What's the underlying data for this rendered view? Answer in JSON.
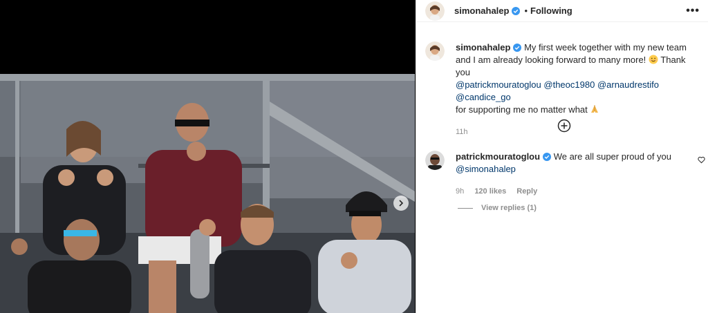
{
  "post": {
    "author": "simonahalep",
    "follow_status": "Following",
    "more_label": "•••",
    "caption": {
      "user": "simonahalep",
      "text_before": "My first week together with my new team and I am already looking forward to many more!",
      "text_thanks": "Thank you",
      "mentions": [
        "@patrickmouratoglou",
        "@theoc1980",
        "@arnaudrestifo",
        "@candice_go"
      ],
      "text_after": "for supporting me no matter what",
      "time": "11h"
    }
  },
  "comment": {
    "user": "patrickmouratoglou",
    "text": "We are all super proud of you",
    "mention": "@simonahalep",
    "time": "9h",
    "likes": "120 likes",
    "reply_label": "Reply",
    "view_replies": "View replies (1)"
  },
  "colors": {
    "verified": "#3897f0",
    "mention": "#00376b",
    "meta": "#8e8e8e"
  },
  "icons": {
    "more": "more-options-icon",
    "verified": "verified-badge-icon",
    "load_more": "plus-circle-icon",
    "like": "heart-icon",
    "carousel_next": "chevron-right-icon"
  }
}
